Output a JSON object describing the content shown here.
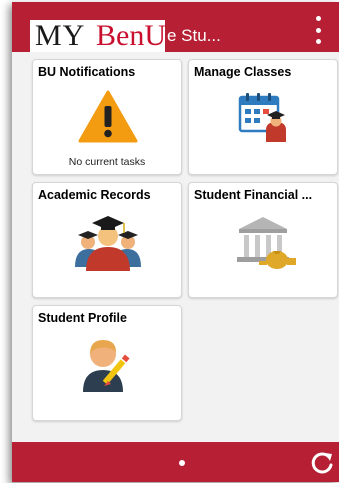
{
  "header": {
    "logo_my": "MY",
    "logo_bu": "BenU",
    "title": "e Stu..."
  },
  "tiles": [
    {
      "title": "BU Notifications",
      "subtitle": "No current tasks",
      "icon": "warning-icon"
    },
    {
      "title": "Manage Classes",
      "subtitle": "",
      "icon": "calendar-graduate-icon"
    },
    {
      "title": "Academic Records",
      "subtitle": "",
      "icon": "graduates-group-icon"
    },
    {
      "title": "Student Financial ...",
      "subtitle": "",
      "icon": "bank-money-icon"
    },
    {
      "title": "Student Profile",
      "subtitle": "",
      "icon": "user-edit-icon"
    }
  ],
  "colors": {
    "brand_red": "#b61f34",
    "warning_orange": "#f39c12",
    "calendar_blue": "#2f7bbf"
  }
}
